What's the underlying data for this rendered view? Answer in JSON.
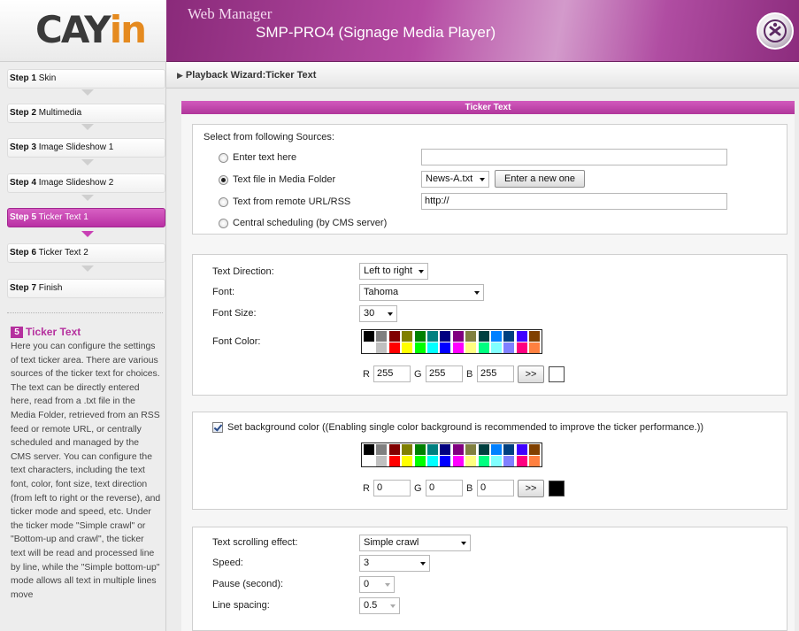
{
  "logo": {
    "text_main": "CAY",
    "text_accent": "in"
  },
  "header": {
    "web_manager": "Web Manager",
    "product": "SMP-PRO4 (Signage Media Player)"
  },
  "steps": [
    {
      "num": "Step 1",
      "name": "Skin",
      "active": false
    },
    {
      "num": "Step 2",
      "name": "Multimedia",
      "active": false
    },
    {
      "num": "Step 3",
      "name": "Image Slideshow 1",
      "active": false
    },
    {
      "num": "Step 4",
      "name": "Image Slideshow 2",
      "active": false
    },
    {
      "num": "Step 5",
      "name": "Ticker Text 1",
      "active": true
    },
    {
      "num": "Step 6",
      "name": "Ticker Text 2",
      "active": false
    },
    {
      "num": "Step 7",
      "name": "Finish",
      "active": false
    }
  ],
  "help": {
    "step_number": "5",
    "title": "Ticker Text",
    "body": "Here you can configure the settings of text ticker area. There are various sources of the ticker text for choices. The text can be directly entered here, read from a .txt file in the Media Folder, retrieved from an RSS feed or remote URL, or centrally scheduled and managed by the CMS server. You can configure the text characters, including the text font, color, font size, text direction (from left to right or the reverse), and ticker mode and speed, etc. Under the ticker mode \"Simple crawl\" or \"Bottom-up and crawl\", the ticker text will be read and processed line by line, while the \"Simple bottom-up\" mode allows all text in multiple lines move"
  },
  "breadcrumb": "Playback Wizard:Ticker Text",
  "section_title": "Ticker Text",
  "sources": {
    "heading": "Select from following Sources:",
    "options": [
      {
        "label": "Enter text here",
        "checked": false
      },
      {
        "label": "Text file in Media Folder",
        "checked": true
      },
      {
        "label": "Text from remote URL/RSS",
        "checked": false
      },
      {
        "label": "Central scheduling (by CMS server)",
        "checked": false
      }
    ],
    "enter_text_value": "",
    "media_file_selected": "News-A.txt",
    "enter_new_button": "Enter a new one",
    "url_value": "http://"
  },
  "font_settings": {
    "direction_label": "Text Direction:",
    "direction_value": "Left to right",
    "font_label": "Font:",
    "font_value": "Tahoma",
    "size_label": "Font Size:",
    "size_value": "30",
    "color_label": "Font Color:",
    "r": "255",
    "g": "255",
    "b": "255",
    "apply_button": ">>",
    "preview_color": "#ffffff"
  },
  "background": {
    "checked": true,
    "label": "Set background color ((Enabling single color background is recommended to improve the ticker performance.))",
    "r": "0",
    "g": "0",
    "b": "0",
    "apply_button": ">>",
    "preview_color": "#000000"
  },
  "scrolling": {
    "effect_label": "Text scrolling effect:",
    "effect_value": "Simple crawl",
    "speed_label": "Speed:",
    "speed_value": "3",
    "pause_label": "Pause (second):",
    "pause_value": "0",
    "spacing_label": "Line spacing:",
    "spacing_value": "0.5"
  },
  "rgb_labels": {
    "r": "R",
    "g": "G",
    "b": "B"
  },
  "palette_colors": {
    "row1": [
      "#000000",
      "#808080",
      "#800000",
      "#808000",
      "#008000",
      "#008080",
      "#000080",
      "#800080",
      "#808040",
      "#004040",
      "#0080ff",
      "#004080",
      "#4000ff",
      "#804000"
    ],
    "row2": [
      "#ffffff",
      "#c0c0c0",
      "#ff0000",
      "#ffff00",
      "#00ff00",
      "#00ffff",
      "#0000ff",
      "#ff00ff",
      "#ffff80",
      "#00ff80",
      "#80ffff",
      "#8080ff",
      "#ff0080",
      "#ff8040"
    ]
  }
}
